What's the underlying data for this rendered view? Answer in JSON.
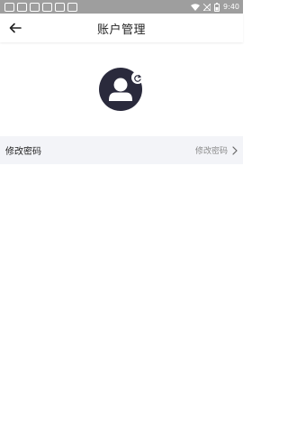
{
  "status_bar": {
    "time": "9:40",
    "icons": [
      "notification-icon",
      "notification-icon",
      "notification-icon",
      "notification-icon",
      "notification-icon",
      "notification-icon",
      "wifi-icon",
      "signal-icon",
      "battery-icon"
    ]
  },
  "header": {
    "title": "账户管理",
    "back_icon": "arrow-left-icon"
  },
  "profile": {
    "avatar_icon": "user-avatar-icon",
    "edit_icon": "refresh-icon"
  },
  "settings": {
    "rows": [
      {
        "label": "修改密码",
        "value": "修改密码",
        "icon": "chevron-right-icon"
      }
    ]
  },
  "colors": {
    "status_bar": "#9e9e9e",
    "avatar_bg": "#2a2a3c",
    "row_bg": "#f3f4f8",
    "muted_text": "#8a8a8a"
  }
}
